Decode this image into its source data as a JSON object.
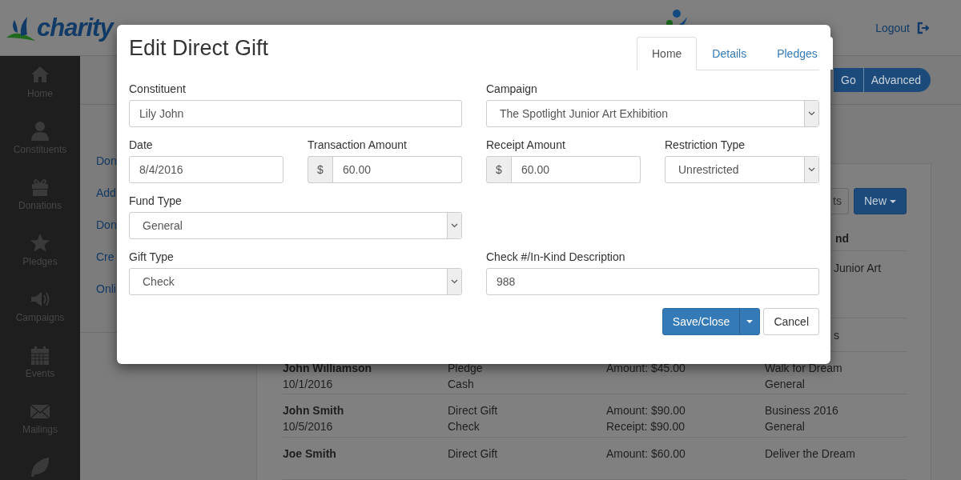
{
  "header": {
    "logo_text": "charity",
    "logout": "Logout"
  },
  "sidebar": {
    "items": [
      {
        "label": "Home"
      },
      {
        "label": "Constituents"
      },
      {
        "label": "Donations"
      },
      {
        "label": "Pledges"
      },
      {
        "label": "Campaigns"
      },
      {
        "label": "Events"
      },
      {
        "label": "Mailings"
      }
    ]
  },
  "toolbar": {
    "buttons": [
      "Go",
      "Advanced"
    ]
  },
  "submenu": {
    "items": [
      "Don",
      "Add",
      "Don",
      "Cre",
      "Onli"
    ]
  },
  "panel": {
    "buttons": [
      {
        "label": "ts",
        "kind": "default"
      },
      {
        "label": "New",
        "kind": "dropdown"
      }
    ],
    "column_header": "nd",
    "partial_texts": [
      "Junior Art",
      "s"
    ],
    "rows": [
      {
        "name": "John Williamson",
        "date": "10/1/2016",
        "type": "Pledge",
        "method": "Cash",
        "amounts": [
          "Amount: $45.00"
        ],
        "campaign": "Walk for Dream",
        "fund": "General"
      },
      {
        "name": "John Smith",
        "date": "10/5/2016",
        "type": "Direct Gift",
        "method": "Check",
        "amounts": [
          "Amount: $90.00",
          "Receipt: $90.00"
        ],
        "campaign": "Business 2016",
        "fund": "General"
      },
      {
        "name": "Joe Smith",
        "type": "Direct Gift",
        "amounts": [
          "Amount: $60.00"
        ],
        "campaign": "Deliver the Dream"
      }
    ]
  },
  "dialog": {
    "title": "Edit Direct Gift",
    "tabs": [
      {
        "label": "Home",
        "selected": true
      },
      {
        "label": "Details",
        "selected": false
      },
      {
        "label": "Pledges",
        "selected": false
      }
    ],
    "rows": [
      [
        {
          "label": "Constituent",
          "kind": "text",
          "value": "Lily John"
        },
        {
          "label": "Campaign",
          "kind": "select",
          "value": "The Spotlight Junior Art Exhibition"
        }
      ],
      [
        {
          "label": "Date",
          "kind": "text",
          "value": "8/4/2016"
        },
        {
          "label": "Transaction Amount",
          "kind": "currency",
          "prefix": "$",
          "value": "60.00"
        },
        {
          "label": "Receipt Amount",
          "kind": "currency",
          "prefix": "$",
          "value": "60.00"
        },
        {
          "label": "Restriction Type",
          "kind": "select",
          "value": "Unrestricted"
        }
      ],
      [
        {
          "label": "Fund Type",
          "kind": "select",
          "value": "General"
        }
      ],
      [
        {
          "label": "Gift Type",
          "kind": "select",
          "value": "Check"
        },
        {
          "label": "Check #/In-Kind Description",
          "kind": "text",
          "value": "988"
        }
      ]
    ],
    "save": "Save/Close",
    "cancel": "Cancel"
  }
}
